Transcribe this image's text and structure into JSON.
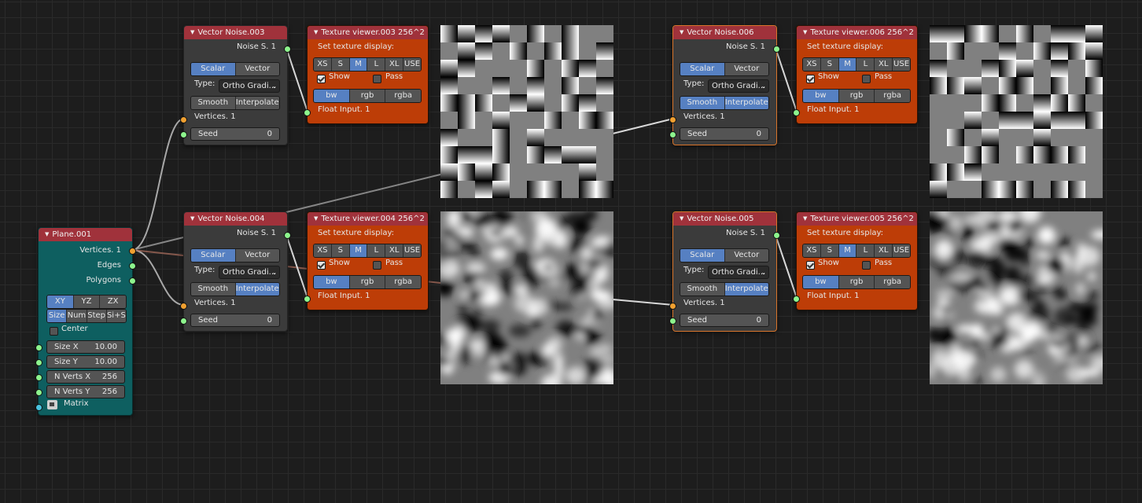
{
  "plane": {
    "title": "Plane.001",
    "outputs": [
      "Vertices. 1",
      "Edges",
      "Polygons"
    ],
    "mode_options": [
      "XY",
      "YZ",
      "ZX"
    ],
    "mode_selected": "XY",
    "dim_options": [
      "Size",
      "Num",
      "Step",
      "Si+S"
    ],
    "dim_selected": "Size",
    "center_label": "Center",
    "center_checked": false,
    "size_x_label": "Size X",
    "size_x": "10.00",
    "size_y_label": "Size Y",
    "size_y": "10.00",
    "nverts_x_label": "N Verts X",
    "nverts_x": "256",
    "nverts_y_label": "N Verts Y",
    "nverts_y": "256",
    "matrix_label": "Matrix"
  },
  "noise_nodes": [
    {
      "title": "Vector Noise.003",
      "output": "Noise S. 1",
      "out_scalar": "Scalar",
      "out_vector": "Vector",
      "type_label": "Type:",
      "type_value": "Ortho Gradi...",
      "smooth": "Smooth",
      "interpolate": "Interpolate",
      "vertices": "Vertices. 1",
      "seed_label": "Seed",
      "seed": "0"
    },
    {
      "title": "Vector Noise.004",
      "output": "Noise S. 1",
      "out_scalar": "Scalar",
      "out_vector": "Vector",
      "type_label": "Type:",
      "type_value": "Ortho Gradi...",
      "smooth": "Smooth",
      "interpolate": "Interpolate",
      "vertices": "Vertices. 1",
      "seed_label": "Seed",
      "seed": "0"
    },
    {
      "title": "Vector Noise.006",
      "output": "Noise S. 1",
      "out_scalar": "Scalar",
      "out_vector": "Vector",
      "type_label": "Type:",
      "type_value": "Ortho Gradi...",
      "smooth": "Smooth",
      "interpolate": "Interpolate",
      "vertices": "Vertices. 1",
      "seed_label": "Seed",
      "seed": "0"
    },
    {
      "title": "Vector Noise.005",
      "output": "Noise S. 1",
      "out_scalar": "Scalar",
      "out_vector": "Vector",
      "type_label": "Type:",
      "type_value": "Ortho Gradi...",
      "smooth": "Smooth",
      "interpolate": "Interpolate",
      "vertices": "Vertices. 1",
      "seed_label": "Seed",
      "seed": "0"
    }
  ],
  "viewer_nodes": [
    {
      "title": "Texture viewer.003 256^2",
      "display_label": "Set texture display:",
      "sizes": [
        "XS",
        "S",
        "M",
        "L",
        "XL",
        "USE"
      ],
      "size_selected": "M",
      "show": "Show",
      "pass": "Pass",
      "modes": [
        "bw",
        "rgb",
        "rgba"
      ],
      "mode_selected": "bw",
      "input": "Float Input. 1"
    },
    {
      "title": "Texture viewer.004 256^2",
      "display_label": "Set texture display:",
      "sizes": [
        "XS",
        "S",
        "M",
        "L",
        "XL",
        "USE"
      ],
      "size_selected": "M",
      "show": "Show",
      "pass": "Pass",
      "modes": [
        "bw",
        "rgb",
        "rgba"
      ],
      "mode_selected": "bw",
      "input": "Float Input. 1"
    },
    {
      "title": "Texture viewer.006 256^2",
      "display_label": "Set texture display:",
      "sizes": [
        "XS",
        "S",
        "M",
        "L",
        "XL",
        "USE"
      ],
      "size_selected": "M",
      "show": "Show",
      "pass": "Pass",
      "modes": [
        "bw",
        "rgb",
        "rgba"
      ],
      "mode_selected": "bw",
      "input": "Float Input. 1"
    },
    {
      "title": "Texture viewer.005 256^2",
      "display_label": "Set texture display:",
      "sizes": [
        "XS",
        "S",
        "M",
        "L",
        "XL",
        "USE"
      ],
      "size_selected": "M",
      "show": "Show",
      "pass": "Pass",
      "modes": [
        "bw",
        "rgb",
        "rgba"
      ],
      "mode_selected": "bw",
      "input": "Float Input. 1"
    }
  ],
  "colors": {
    "header": "#a0323b",
    "gray_node": "#3b3b3b",
    "orange_node": "#bd3d07",
    "teal_node": "#0e5f60",
    "toggle_on": "#5680c2",
    "socket_green": "#8df58d",
    "socket_orange": "#f0a030",
    "socket_blue": "#4ac4e0"
  }
}
